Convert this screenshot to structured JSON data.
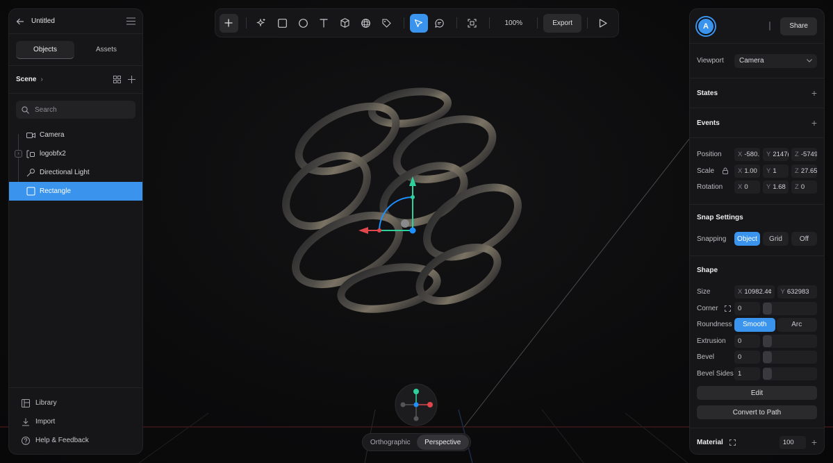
{
  "document": {
    "title": "Untitled"
  },
  "left_panel": {
    "tabs": [
      {
        "label": "Objects",
        "active": true
      },
      {
        "label": "Assets",
        "active": false
      }
    ],
    "scene": {
      "label": "Scene"
    },
    "search": {
      "placeholder": "Search"
    },
    "tree": [
      {
        "label": "Camera",
        "icon": "camera-icon"
      },
      {
        "label": "logobfx2",
        "icon": "group-icon"
      },
      {
        "label": "Directional Light",
        "icon": "directional-light-icon"
      },
      {
        "label": "Rectangle",
        "icon": "rectangle-icon",
        "selected": true
      }
    ],
    "bottom": [
      {
        "label": "Library",
        "icon": "library-icon"
      },
      {
        "label": "Import",
        "icon": "import-icon"
      },
      {
        "label": "Help & Feedback",
        "icon": "help-icon"
      }
    ]
  },
  "toolbar": {
    "zoom": "100%",
    "export_label": "Export",
    "tools": [
      "add",
      "ai-generate",
      "rectangle",
      "ellipse",
      "text",
      "cube",
      "sphere",
      "tag",
      "select",
      "comment",
      "frame",
      "play"
    ],
    "active_tool": "select"
  },
  "view_toggle": {
    "options": [
      "Orthographic",
      "Perspective"
    ],
    "active": "Perspective"
  },
  "right_panel": {
    "avatar_initial": "A",
    "share_label": "Share",
    "viewport": {
      "label": "Viewport",
      "value": "Camera"
    },
    "states": {
      "label": "States"
    },
    "events": {
      "label": "Events"
    },
    "transform": {
      "position": {
        "label": "Position",
        "x": "-580.",
        "y": "2147(",
        "z": "-5749"
      },
      "scale": {
        "label": "Scale",
        "x": "1.00",
        "y": "1",
        "z": "27.65"
      },
      "rotation": {
        "label": "Rotation",
        "x": "0",
        "y": "1.68",
        "z": "0"
      }
    },
    "snap": {
      "title": "Snap Settings",
      "label": "Snapping",
      "options": [
        "Object",
        "Grid",
        "Off"
      ],
      "active": "Object"
    },
    "shape": {
      "title": "Shape",
      "size": {
        "label": "Size",
        "x": "10982.4¢",
        "y": "632983"
      },
      "corner": {
        "label": "Corner",
        "value": "0"
      },
      "roundness": {
        "label": "Roundness",
        "options": [
          "Smooth",
          "Arc"
        ],
        "active": "Smooth"
      },
      "extrusion": {
        "label": "Extrusion",
        "value": "0"
      },
      "bevel": {
        "label": "Bevel",
        "value": "0"
      },
      "bevel_sides": {
        "label": "Bevel Sides",
        "value": "1"
      },
      "edit_label": "Edit",
      "convert_label": "Convert to Path"
    },
    "material": {
      "label": "Material",
      "value": "100"
    }
  },
  "colors": {
    "accent": "#3a94ee",
    "panel": "#161618",
    "background": "#0a0a0b",
    "axis_x": "#e0464b",
    "axis_y": "#2fd19a",
    "axis_z": "#1e90ff"
  }
}
